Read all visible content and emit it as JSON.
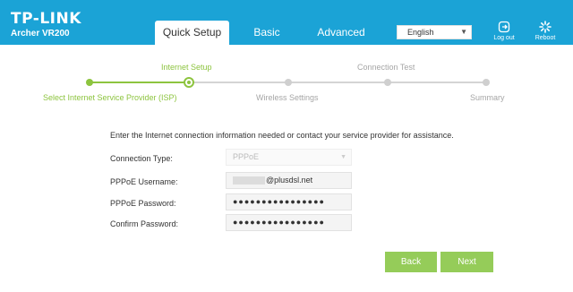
{
  "header": {
    "brand": "TP-LINK",
    "model": "Archer VR200",
    "tabs": [
      {
        "label": "Quick Setup",
        "active": true
      },
      {
        "label": "Basic",
        "active": false
      },
      {
        "label": "Advanced",
        "active": false
      }
    ],
    "language": "English",
    "logout_label": "Log out",
    "reboot_label": "Reboot",
    "bar_color": "#1ba3d6"
  },
  "progress": {
    "steps_top": [
      "Internet Setup",
      "Connection Test"
    ],
    "steps_bottom": [
      "Select Internet Service Provider (ISP)",
      "Wireless Settings",
      "Summary"
    ],
    "done_color": "#8dc43f",
    "todo_color": "#cfcfcf"
  },
  "form": {
    "intro": "Enter the Internet connection information needed or contact your service provider for assistance.",
    "connection_type_label": "Connection Type:",
    "connection_type_value": "PPPoE",
    "username_label": "PPPoE Username:",
    "username_value": "@plusdsl.net",
    "password_label": "PPPoE Password:",
    "password_value": "●●●●●●●●●●●●●●●●",
    "confirm_label": "Confirm Password:",
    "confirm_value": "●●●●●●●●●●●●●●●●"
  },
  "buttons": {
    "back": "Back",
    "next": "Next",
    "color": "#95cc59"
  }
}
